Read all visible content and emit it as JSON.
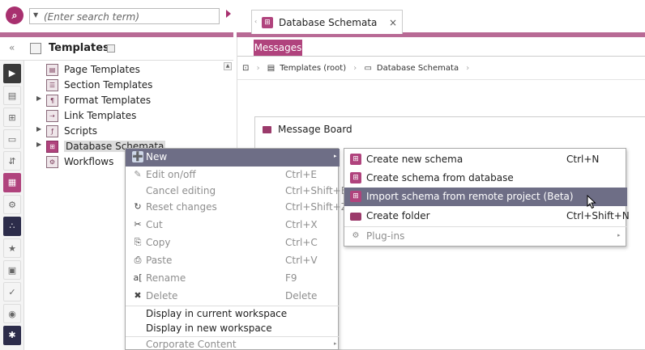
{
  "search": {
    "placeholder": "(Enter search term)",
    "logo_glyph": "⌕"
  },
  "editor_tab": {
    "label": "Database Schemata",
    "close_glyph": "×",
    "lead_glyph": "‹"
  },
  "tree_panel": {
    "collapse_glyph": "«",
    "title": "Templates",
    "items": [
      {
        "label": "Page Templates",
        "caret": ""
      },
      {
        "label": "Section Templates",
        "caret": ""
      },
      {
        "label": "Format Templates",
        "caret": "▶"
      },
      {
        "label": "Link Templates",
        "caret": ""
      },
      {
        "label": "Scripts",
        "caret": "▶"
      },
      {
        "label": "Database Schemata",
        "caret": "▶"
      },
      {
        "label": "Workflows",
        "caret": ""
      }
    ]
  },
  "rail": {
    "buttons": [
      "▶",
      "▤",
      "⊞",
      "▭",
      "⇵",
      "▦",
      "⚙",
      "∴",
      "★",
      "▣",
      "✓",
      "◉",
      "✱"
    ]
  },
  "workspace": {
    "messages_tab": "Messages",
    "breadcrumb": {
      "root": "Templates (root)",
      "current": "Database Schemata",
      "sep": "›"
    },
    "message_board_title": "Message Board"
  },
  "context_menu": {
    "items": [
      {
        "label": "New",
        "shortcut": "",
        "arrow": "▸",
        "icon": "➕",
        "state": "highlight"
      },
      {
        "label": "Edit on/off",
        "shortcut": "Ctrl+E",
        "arrow": "",
        "icon": "✎",
        "state": "disabled"
      },
      {
        "label": "Cancel editing",
        "shortcut": "Ctrl+Shift+E",
        "arrow": "",
        "icon": "",
        "state": "disabled"
      },
      {
        "label": "Reset changes",
        "shortcut": "Ctrl+Shift+Z",
        "arrow": "",
        "icon": "↻",
        "state": "disabled"
      },
      {
        "label": "Cut",
        "shortcut": "Ctrl+X",
        "arrow": "",
        "icon": "✂",
        "state": "disabled"
      },
      {
        "label": "Copy",
        "shortcut": "Ctrl+C",
        "arrow": "",
        "icon": "⎘",
        "state": "disabled"
      },
      {
        "label": "Paste",
        "shortcut": "Ctrl+V",
        "arrow": "",
        "icon": "⎙",
        "state": "disabled"
      },
      {
        "label": "Rename",
        "shortcut": "F9",
        "arrow": "",
        "icon": "a[",
        "state": "disabled"
      },
      {
        "label": "Delete",
        "shortcut": "Delete",
        "arrow": "",
        "icon": "✖",
        "state": "disabled"
      },
      {
        "label": "Display in current workspace",
        "shortcut": "",
        "arrow": "",
        "icon": "",
        "state": "normal"
      },
      {
        "label": "Display in new workspace",
        "shortcut": "",
        "arrow": "",
        "icon": "",
        "state": "normal"
      },
      {
        "label": "Corporate Content",
        "shortcut": "",
        "arrow": "▸",
        "icon": "",
        "state": "disabled"
      }
    ]
  },
  "submenu": {
    "items": [
      {
        "label": "Create new schema",
        "shortcut": "Ctrl+N",
        "arrow": "",
        "icon": "⊞",
        "state": "normal"
      },
      {
        "label": "Create schema from database",
        "shortcut": "",
        "arrow": "",
        "icon": "⊞",
        "state": "normal"
      },
      {
        "label": "Import schema from remote project (Beta)",
        "shortcut": "",
        "arrow": "",
        "icon": "⊞",
        "state": "highlight"
      },
      {
        "label": "Create folder",
        "shortcut": "Ctrl+Shift+N",
        "arrow": "",
        "icon": "",
        "state": "normal"
      },
      {
        "label": "Plug-ins",
        "shortcut": "",
        "arrow": "▸",
        "icon": "⚙",
        "state": "disabled"
      }
    ]
  },
  "colors": {
    "brand": "#b0437d",
    "highlight": "#6e6e86",
    "stripe": "#b86a95"
  }
}
